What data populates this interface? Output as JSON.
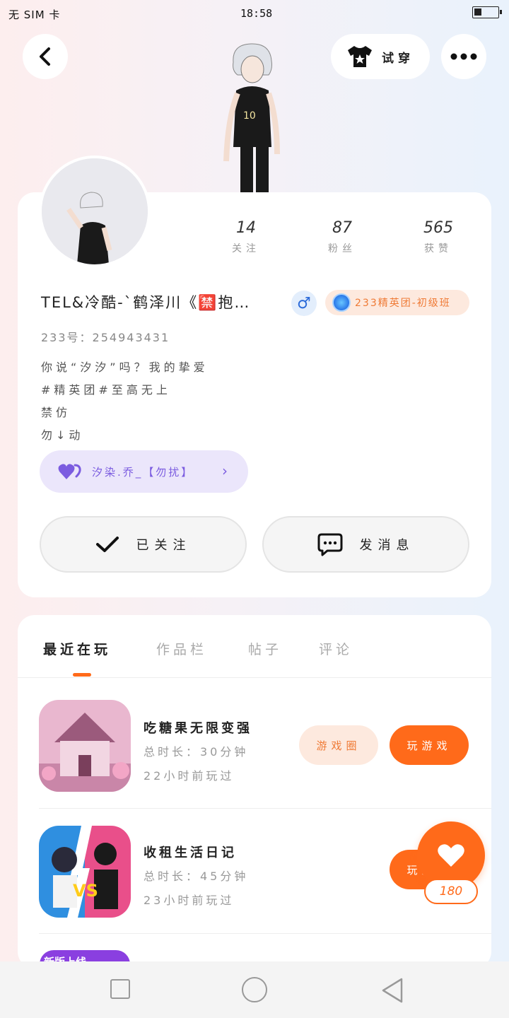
{
  "status_bar": {
    "carrier": "无 SIM 卡",
    "time": "18:58"
  },
  "header": {
    "back_icon": "chevron-left-icon",
    "try_on_label": "试穿",
    "more_icon": "more-dots-icon"
  },
  "stats": [
    {
      "value": "14",
      "label": "关注"
    },
    {
      "value": "87",
      "label": "粉丝"
    },
    {
      "value": "565",
      "label": "获赞"
    }
  ],
  "profile": {
    "name": "TEL&冷酷-`鹤泽川《🈲抱…",
    "gender_symbol": "♂",
    "badge": "233精英团-初级班",
    "account_id": "233号：254943431",
    "bio_lines": [
      "你说“汐汐”吗？我的挚爱",
      "#精英团#至高无上",
      "禁仿",
      "勿↓动"
    ],
    "fan_group": "汐染.乔_【勿扰】"
  },
  "actions": {
    "follow_label": "已关注",
    "message_label": "发消息"
  },
  "tabs": [
    {
      "label": "最近在玩",
      "active": true
    },
    {
      "label": "作品栏",
      "active": false
    },
    {
      "label": "帖子",
      "active": false
    },
    {
      "label": "评论",
      "active": false
    }
  ],
  "games": [
    {
      "title": "吃糖果无限变强",
      "duration": "总时长：30分钟",
      "last_played": "22小时前玩过",
      "circle_label": "游戏圈",
      "play_label": "玩游戏"
    },
    {
      "title": "收租生活日记",
      "duration": "总时长：45分钟",
      "last_played": "23小时前玩过",
      "play_label": "玩游戏"
    }
  ],
  "new_tag": "新版上线",
  "like_fab": {
    "count": "180"
  },
  "colors": {
    "accent": "#ff6a1a",
    "fan_purple": "#7b5ce0",
    "badge_bg": "#fde9de"
  }
}
